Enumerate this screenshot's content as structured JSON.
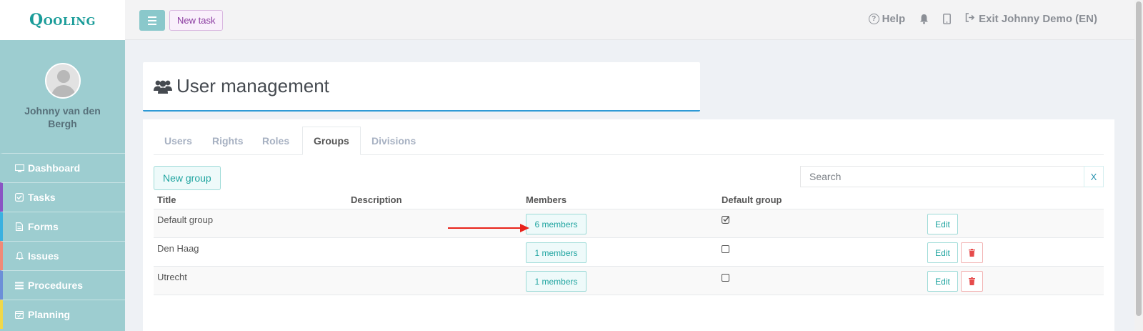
{
  "app": {
    "logo": "Qooling"
  },
  "sidebar": {
    "user_name": "Johnny van den Bergh",
    "items": [
      {
        "label": "Dashboard",
        "icon": "monitor-icon",
        "color": "#9dcdd0"
      },
      {
        "label": "Tasks",
        "icon": "check-square-icon",
        "color": "#8a55c4"
      },
      {
        "label": "Forms",
        "icon": "document-icon",
        "color": "#3ab1e0"
      },
      {
        "label": "Issues",
        "icon": "bell-icon",
        "color": "#f08a78"
      },
      {
        "label": "Procedures",
        "icon": "list-icon",
        "color": "#6c8fd8"
      },
      {
        "label": "Planning",
        "icon": "calendar-icon",
        "color": "#f0d84a"
      }
    ]
  },
  "topbar": {
    "new_task": "New task",
    "help": "Help",
    "exit": "Exit Johnny Demo (EN)"
  },
  "page": {
    "title": "User management"
  },
  "tabs": [
    "Users",
    "Rights",
    "Roles",
    "Groups",
    "Divisions"
  ],
  "active_tab": "Groups",
  "toolbar": {
    "new_group": "New group",
    "search_placeholder": "Search",
    "clear": "X"
  },
  "table": {
    "headers": {
      "title": "Title",
      "description": "Description",
      "members": "Members",
      "default_group": "Default group"
    },
    "edit_label": "Edit",
    "rows": [
      {
        "title": "Default group",
        "description": "",
        "members": "6 members",
        "default": true,
        "deletable": false
      },
      {
        "title": "Den Haag",
        "description": "",
        "members": "1 members",
        "default": false,
        "deletable": true
      },
      {
        "title": "Utrecht",
        "description": "",
        "members": "1 members",
        "default": false,
        "deletable": true
      }
    ]
  },
  "annotation": {
    "color": "#e8231b"
  }
}
